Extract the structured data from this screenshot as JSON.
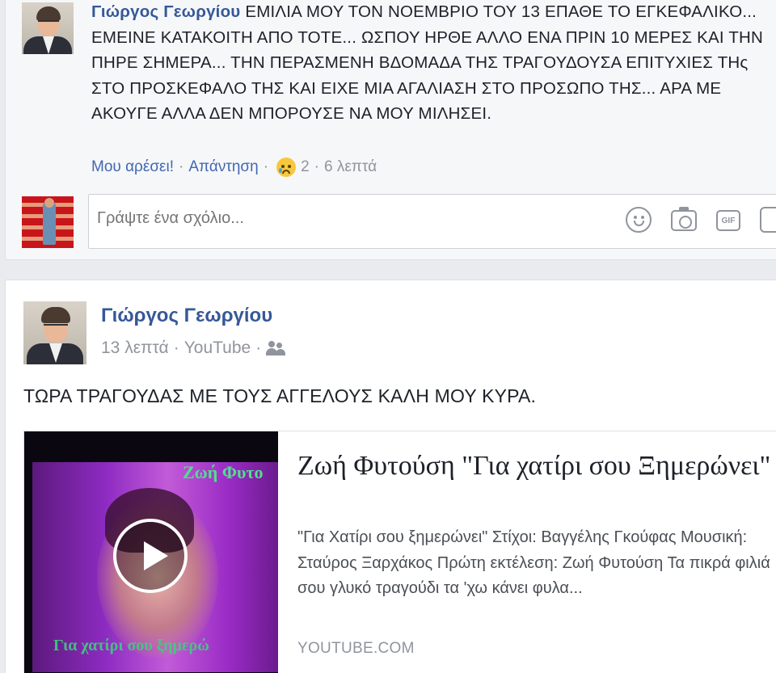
{
  "comment": {
    "author": "Γιώργος Γεωργίου",
    "text": "ΕΜΙΛΙΑ ΜΟΥ ΤΟΝ ΝΟΕΜΒΡΙΟ ΤΟΥ 13 ΕΠΑΘΕ ΤΟ ΕΓΚΕΦΑΛΙΚΟ... ΕΜΕΙΝΕ ΚΑΤΑΚΟΙΤΗ ΑΠΟ ΤΟΤΕ... ΩΣΠΟΥ ΗΡΘΕ ΑΛΛΟ ΕΝΑ ΠΡΙΝ 10 ΜΕΡΕΣ ΚΑΙ ΤΗΝ ΠΗΡΕ ΣΗΜΕΡΑ... ΤΗΝ ΠΕΡΑΣΜΕΝΗ ΒΔΟΜΑΔΑ ΤΗΣ ΤΡΑΓΟΥΔΟΥΣΑ ΕΠΙΤΥΧΙΕΣ ΤΗς ΣΤΟ ΠΡΟΣΚΕΦΑΛΟ ΤΗΣ ΚΑΙ ΕΙΧΕ ΜΙΑ ΑΓΑΛΙΑΣΗ ΣΤΟ ΠΡΟΣΩΠΟ ΤΗΣ... ΑΡΑ ΜΕ ΑΚΟΥΓΕ ΑΛΛΑ ΔΕΝ ΜΠΟΡΟΥΣΕ ΝΑ ΜΟΥ ΜΙΛΗΣΕΙ.",
    "like_label": "Μου αρέσει!",
    "reply_label": "Απάντηση",
    "separator": "·",
    "reaction_icon": "sad-face-icon",
    "reaction_count": "2",
    "time": "6 λεπτά"
  },
  "comment_box": {
    "placeholder": "Γράψτε ένα σχόλιο...",
    "icons": [
      "emoji-icon",
      "camera-icon",
      "gif-icon",
      "sticker-icon"
    ],
    "gif_label": "GIF"
  },
  "post": {
    "author": "Γιώργος Γεωργίου",
    "time": "13 λεπτά",
    "source": "YouTube",
    "separator": "·",
    "audience_icon": "friends-icon",
    "text": "ΤΩΡΑ ΤΡΑΓΟΥΔΑΣ ΜΕ ΤΟΥΣ ΑΓΓΕΛΟΥΣ ΚΑΛΗ ΜΟΥ ΚΥΡΑ.",
    "link": {
      "title": "Ζωή Φυτούση \"Για χατίρι σου Ξημερώνει\"",
      "description": "\"Για Χατίρι σου ξημερώνει\" Στίχοι: Βαγγέλης Γκούφας Μουσική: Σταύρος Ξαρχάκος Πρώτη εκτέλεση: Ζωή Φυτούση Τα πικρά φιλιά σου γλυκό τραγούδι τα 'χω κάνει φυλα...",
      "domain": "YOUTUBE.COM",
      "thumb_overlay_title": "Ζωή Φυτο",
      "thumb_overlay_bottom": "Για χατίρι σου ξημερώ"
    }
  },
  "colors": {
    "link": "#365899",
    "action_link": "#4267b2",
    "meta": "#90949c",
    "background": "#e9ebee"
  }
}
